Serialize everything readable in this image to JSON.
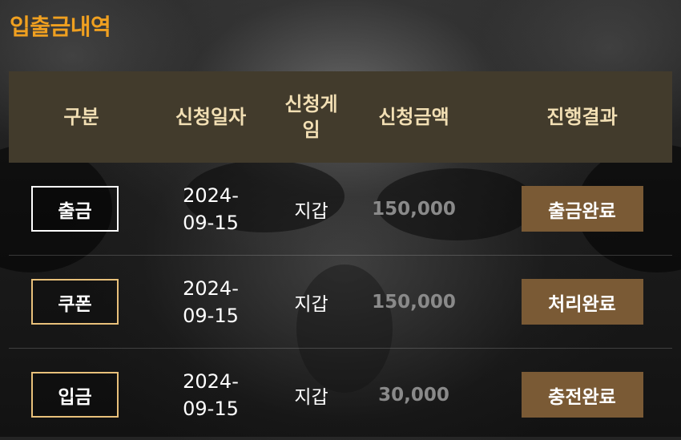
{
  "page": {
    "title": "입출금내역"
  },
  "table": {
    "headers": {
      "type": "구분",
      "date": "신청일자",
      "game": "신청게\n임",
      "amount": "신청금액",
      "result": "진행결과"
    },
    "rows": [
      {
        "type": "출금",
        "type_style": "white",
        "date": "2024-\n09-15",
        "game": "지갑",
        "amount": "150,000",
        "result": "출금완료"
      },
      {
        "type": "쿠폰",
        "type_style": "gold",
        "date": "2024-\n09-15",
        "game": "지갑",
        "amount": "150,000",
        "result": "처리완료"
      },
      {
        "type": "입금",
        "type_style": "gold",
        "date": "2024-\n09-15",
        "game": "지갑",
        "amount": "30,000",
        "result": "충전완료"
      }
    ]
  },
  "colors": {
    "title": "#f0a020",
    "header_bg": "#423b2c",
    "header_text": "#f2dfb4",
    "status_button_bg": "#7a5a35",
    "amount_text": "#8a8a8a"
  }
}
